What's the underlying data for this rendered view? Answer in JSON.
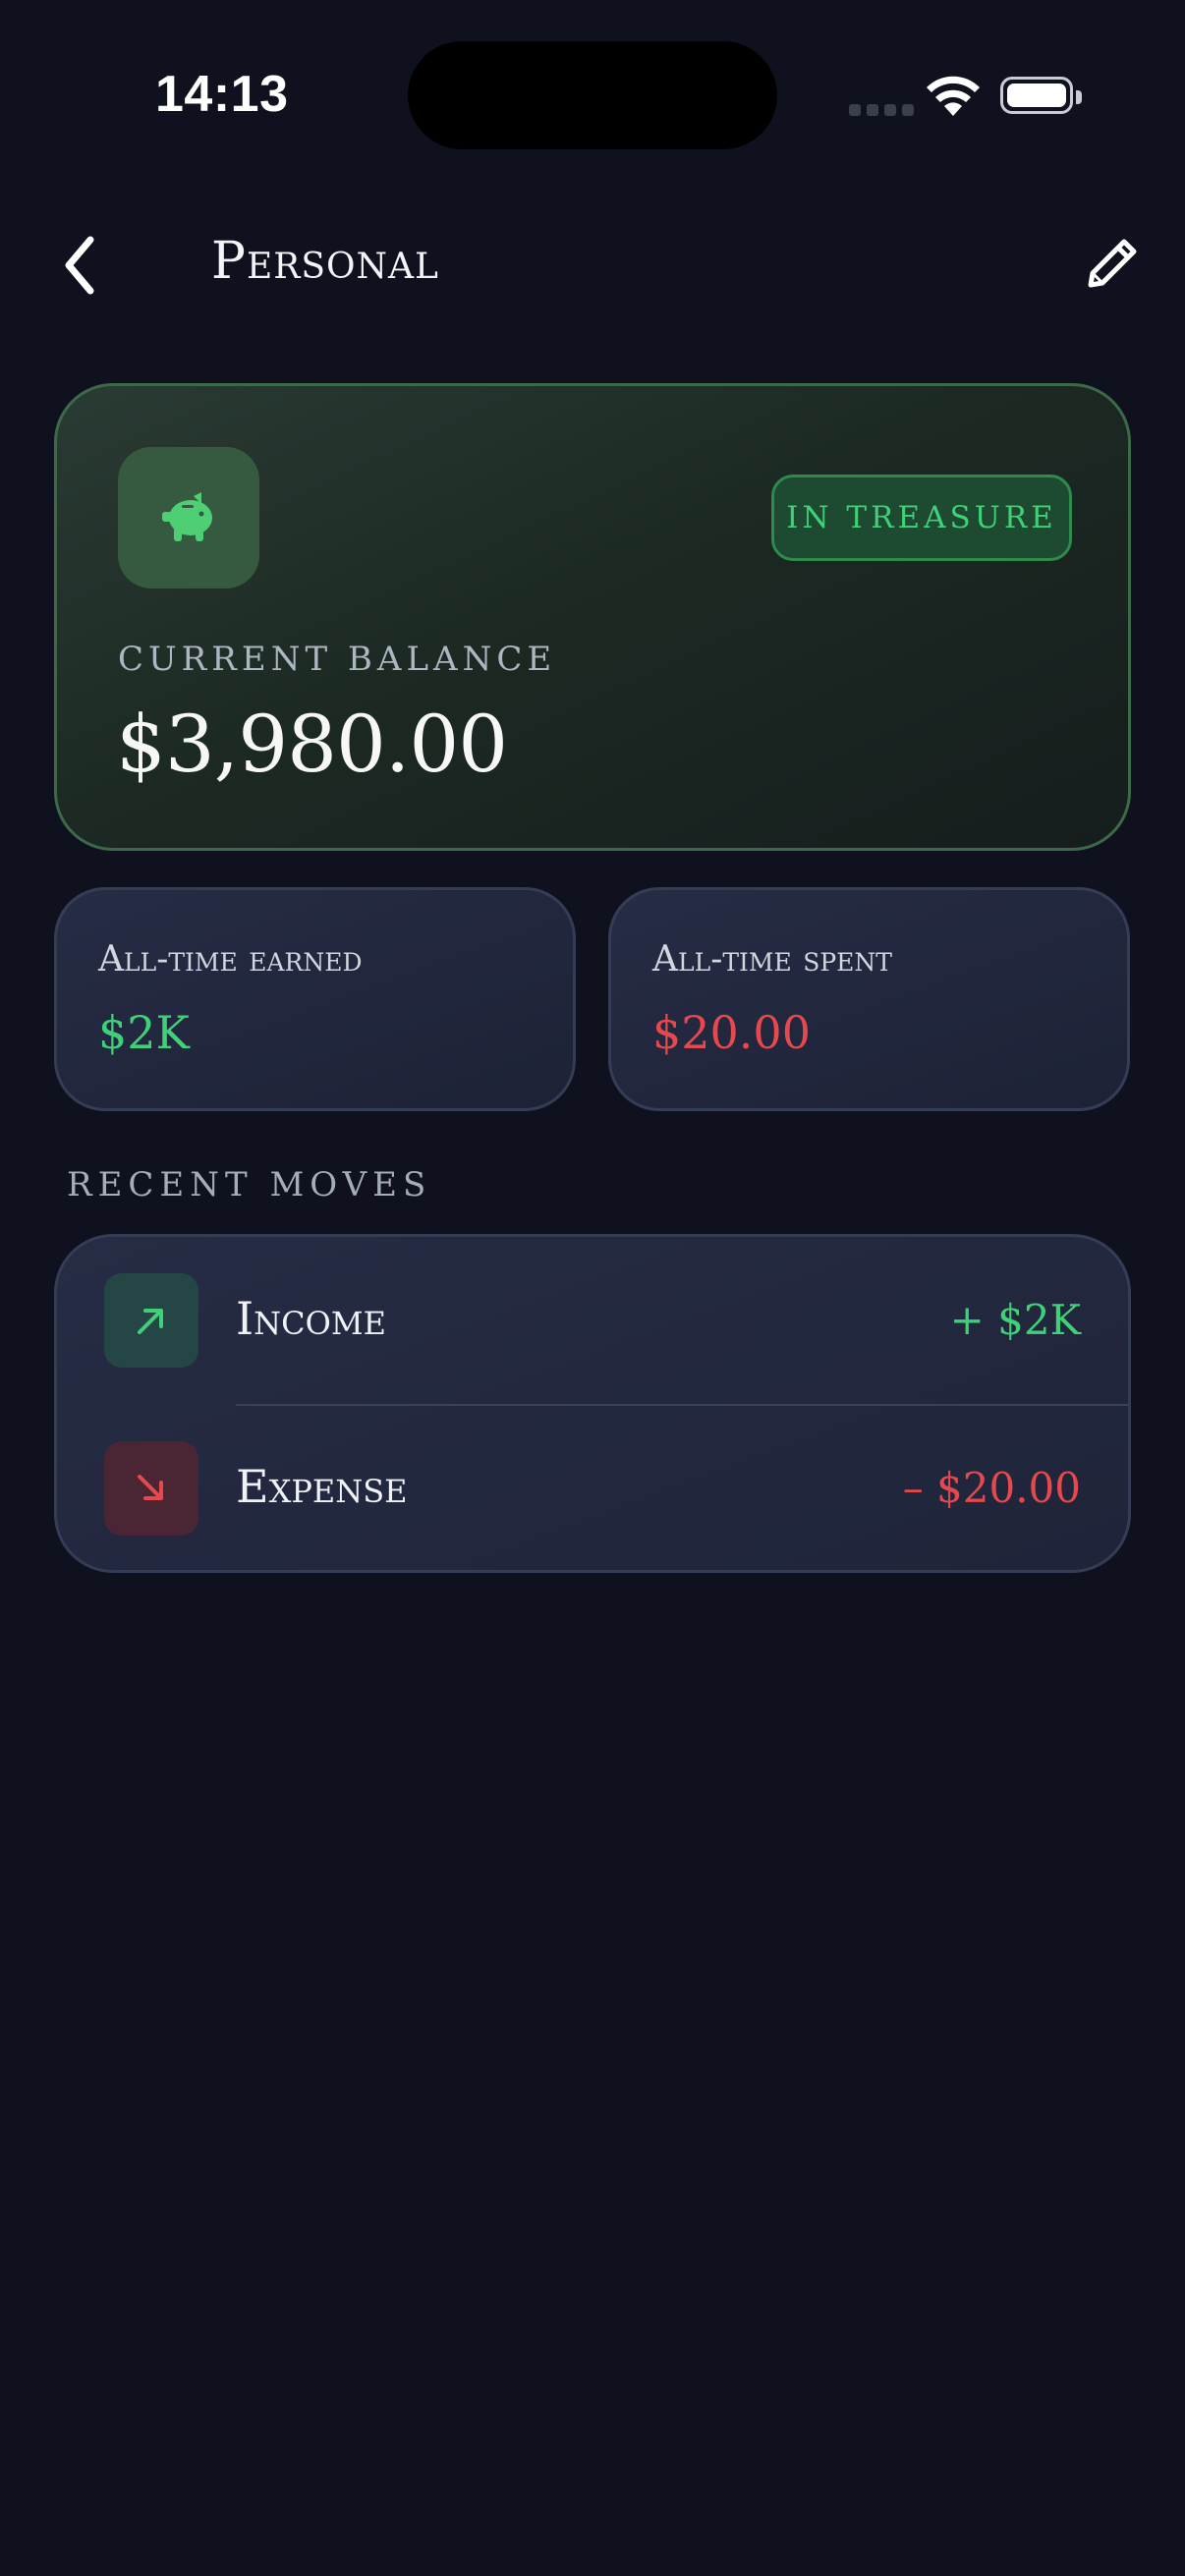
{
  "status_bar": {
    "time": "14:13"
  },
  "header": {
    "title": "Personal"
  },
  "balance_card": {
    "badge": "IN TREASURE",
    "label": "CURRENT BALANCE",
    "value": "$3,980.00"
  },
  "stats": {
    "earned": {
      "label": "All-time earned",
      "value": "$2K"
    },
    "spent": {
      "label": "All-time spent",
      "value": "$20.00"
    }
  },
  "recent": {
    "title": "RECENT MOVES",
    "items": [
      {
        "label": "Income",
        "amount": "+ $2K",
        "icon": "arrow-up-right-icon"
      },
      {
        "label": "Expense",
        "amount": "– $20.00",
        "icon": "arrow-down-right-icon"
      }
    ]
  },
  "colors": {
    "background": "#0f121e",
    "income_green": "#3fd177",
    "expense_red": "#e5484d",
    "card_border_green": "#3c6a48"
  }
}
